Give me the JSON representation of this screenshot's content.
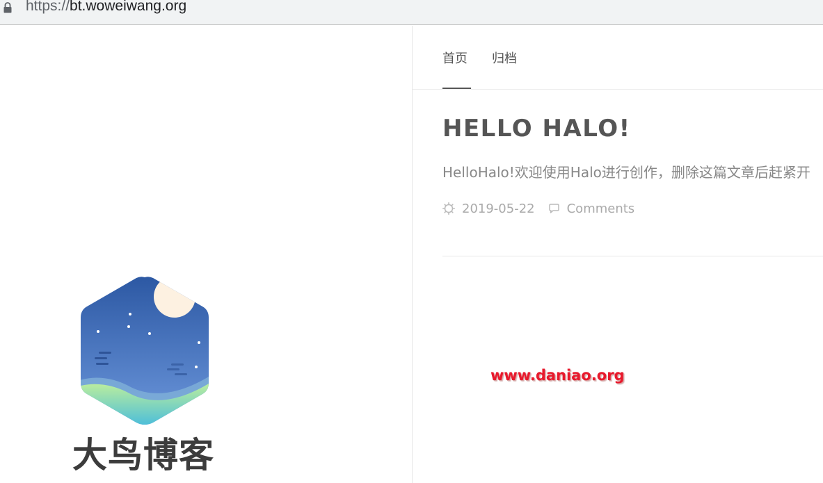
{
  "browser": {
    "url_scheme": "https://",
    "url_host": "bt.woweiwang.org"
  },
  "brand": {
    "logo_text": "大鸟博客",
    "colors": {
      "sky_top": "#2f5fa8",
      "sky_bottom": "#6a93d8",
      "moon": "#fdf3e3",
      "hill_top": "#b9ef9a",
      "hill_bottom": "#5cc3d6"
    }
  },
  "nav": {
    "items": [
      {
        "label": "首页",
        "active": true
      },
      {
        "label": "归档",
        "active": false
      }
    ]
  },
  "post": {
    "title": "HELLO HALO!",
    "excerpt": "HelloHalo!欢迎使用Halo进行创作，删除这篇文章后赶紧开",
    "date": "2019-05-22",
    "comments_label": "Comments",
    "date_icon": "sun-icon",
    "comments_icon": "comment-bubble-icon"
  },
  "watermark": {
    "text": "www.daniao.org",
    "color": "#e8192c"
  }
}
